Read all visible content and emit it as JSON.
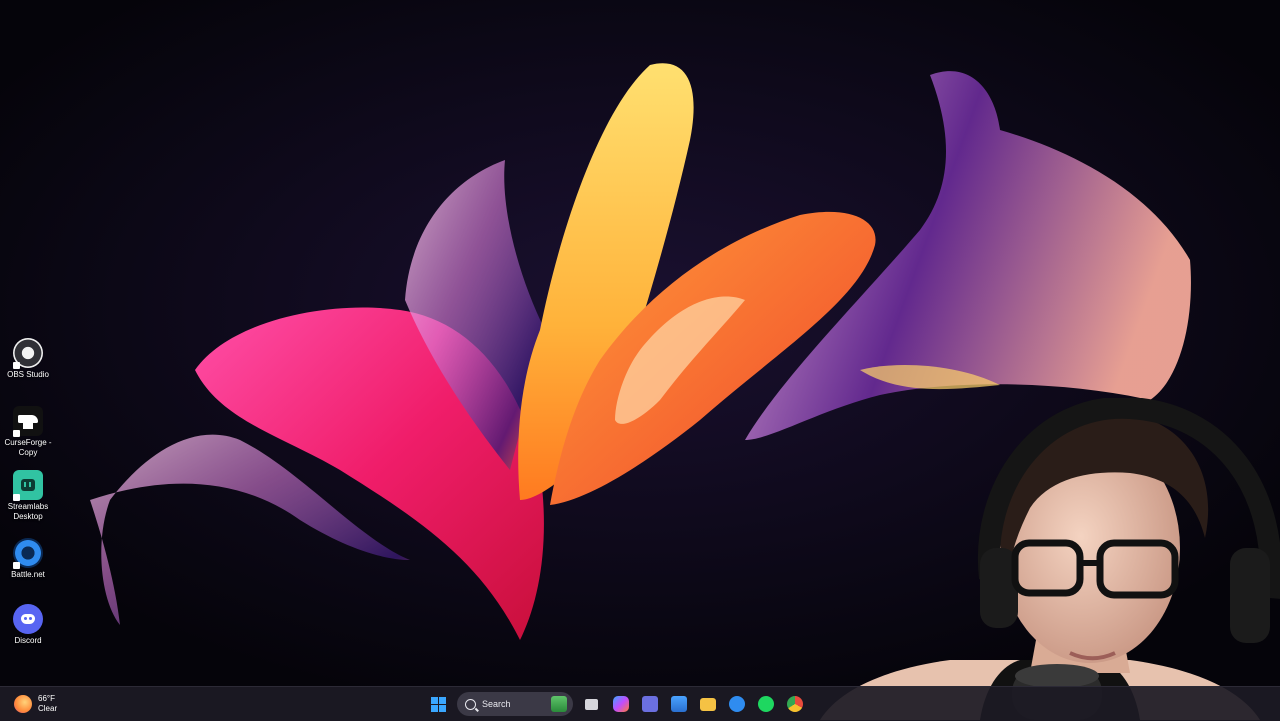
{
  "desktop": {
    "icons": [
      {
        "label": "OBS Studio",
        "icon": "obs-icon"
      },
      {
        "label": "CurseForge - Copy",
        "icon": "curseforge-icon"
      },
      {
        "label": "Streamlabs Desktop",
        "icon": "streamlabs-icon"
      },
      {
        "label": "Battle.net",
        "icon": "battlenet-icon"
      },
      {
        "label": "Discord",
        "icon": "discord-icon"
      }
    ]
  },
  "taskbar": {
    "weather": {
      "temp": "66°F",
      "condition": "Clear",
      "icon": "weather-clear-icon"
    },
    "search_placeholder": "Search",
    "apps": [
      {
        "name": "start-button",
        "icon": "windows-logo-icon"
      },
      {
        "name": "task-view",
        "icon": "task-view-icon",
        "color": "#d6d6dc"
      },
      {
        "name": "copilot",
        "icon": "copilot-icon",
        "color": "#c14cff"
      },
      {
        "name": "teams",
        "icon": "teams-icon",
        "color": "#6b6fe0"
      },
      {
        "name": "microsoft-store",
        "icon": "store-icon",
        "color": "#4aa3ff"
      },
      {
        "name": "file-explorer",
        "icon": "folder-icon",
        "color": "#f5c244"
      },
      {
        "name": "battlenet",
        "icon": "battlenet-icon",
        "color": "#2f8cf0"
      },
      {
        "name": "spotify",
        "icon": "spotify-icon",
        "color": "#1ed760"
      },
      {
        "name": "chrome",
        "icon": "chrome-icon",
        "color": "#e94b3c"
      }
    ]
  },
  "colors": {
    "background": "#07050f",
    "taskbar": "#1c1a24",
    "search_box": "#3b3946",
    "accent": "#3aa7ff"
  }
}
